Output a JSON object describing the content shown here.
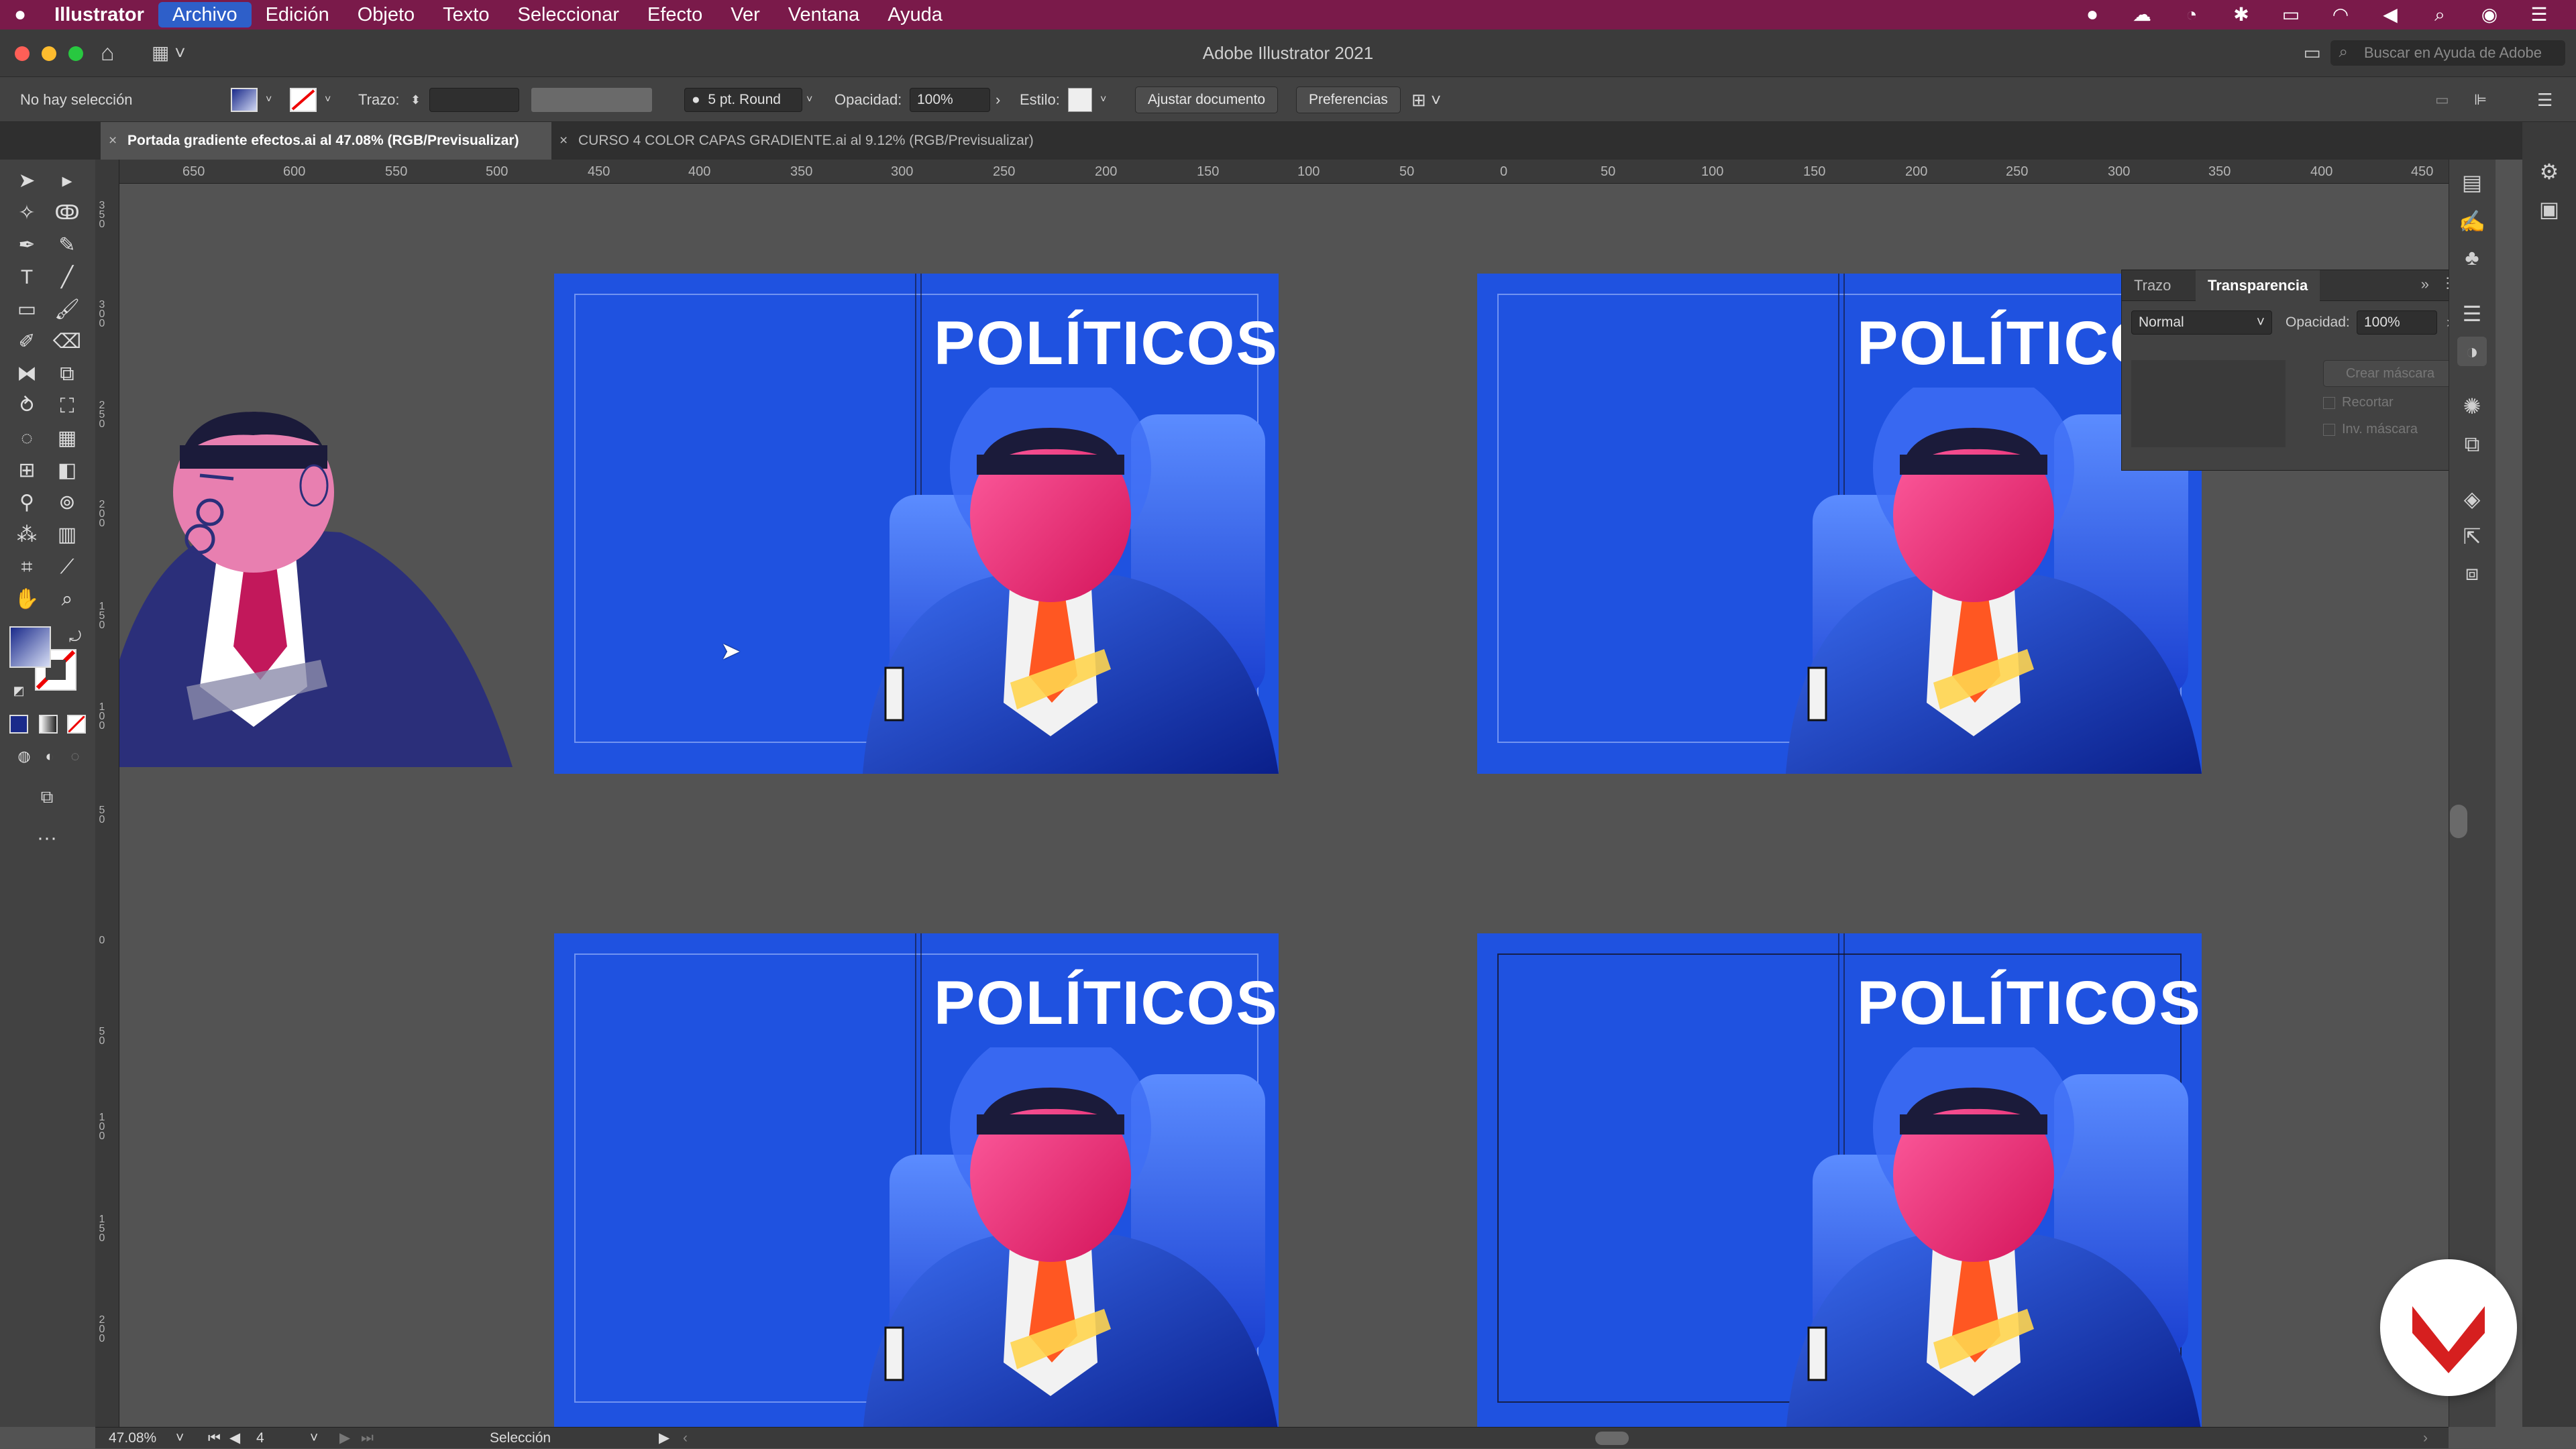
{
  "menubar": {
    "items": [
      "Illustrator",
      "Archivo",
      "Edición",
      "Objeto",
      "Texto",
      "Seleccionar",
      "Efecto",
      "Ver",
      "Ventana",
      "Ayuda"
    ],
    "active_index": 1
  },
  "window": {
    "title": "Adobe Illustrator 2021",
    "search_placeholder": "Buscar en Ayuda de Adobe"
  },
  "controlbar": {
    "selection_label": "No hay selección",
    "stroke_label": "Trazo:",
    "brush_value": "5 pt. Round",
    "opacity_label": "Opacidad:",
    "opacity_value": "100%",
    "style_label": "Estilo:",
    "fit_button": "Ajustar documento",
    "prefs_button": "Preferencias"
  },
  "tabs": [
    {
      "label": "Portada gradiente efectos.ai al 47.08% (RGB/Previsualizar)",
      "active": true
    },
    {
      "label": "CURSO 4 COLOR CAPAS GRADIENTE.ai al 9.12% (RGB/Previsualizar)",
      "active": false
    }
  ],
  "ruler_h": [
    "650",
    "600",
    "550",
    "500",
    "450",
    "400",
    "350",
    "300",
    "250",
    "200",
    "150",
    "100",
    "50",
    "0",
    "50",
    "100",
    "150",
    "200",
    "250",
    "300",
    "350",
    "400",
    "450"
  ],
  "ruler_v": [
    "3 5 0",
    "3 0 0",
    "2 5 0",
    "2 0 0",
    "1 5 0",
    "1 0 0",
    "5 0",
    "0",
    "5 0",
    "1 0 0",
    "1 5 0",
    "2 0 0"
  ],
  "artboards": [
    {
      "logo": "POLÍTICOS"
    },
    {
      "logo": "POLÍTICOS"
    },
    {
      "logo": "POLÍTICOS"
    },
    {
      "logo": "POLÍTICOS"
    }
  ],
  "transparency_panel": {
    "tab_stroke": "Trazo",
    "tab_transparency": "Transparencia",
    "blend_mode": "Normal",
    "opacity_label": "Opacidad:",
    "opacity_value": "100%",
    "make_mask_button": "Crear máscara",
    "clip_label": "Recortar",
    "invert_label": "Inv. máscara"
  },
  "statusbar": {
    "zoom": "47.08%",
    "artboard_number": "4",
    "tool_name": "Selección"
  },
  "colors": {
    "menubar_bg": "#7a1a4a",
    "artboard_blue": "#1f52e0",
    "workspace": "#535353"
  }
}
